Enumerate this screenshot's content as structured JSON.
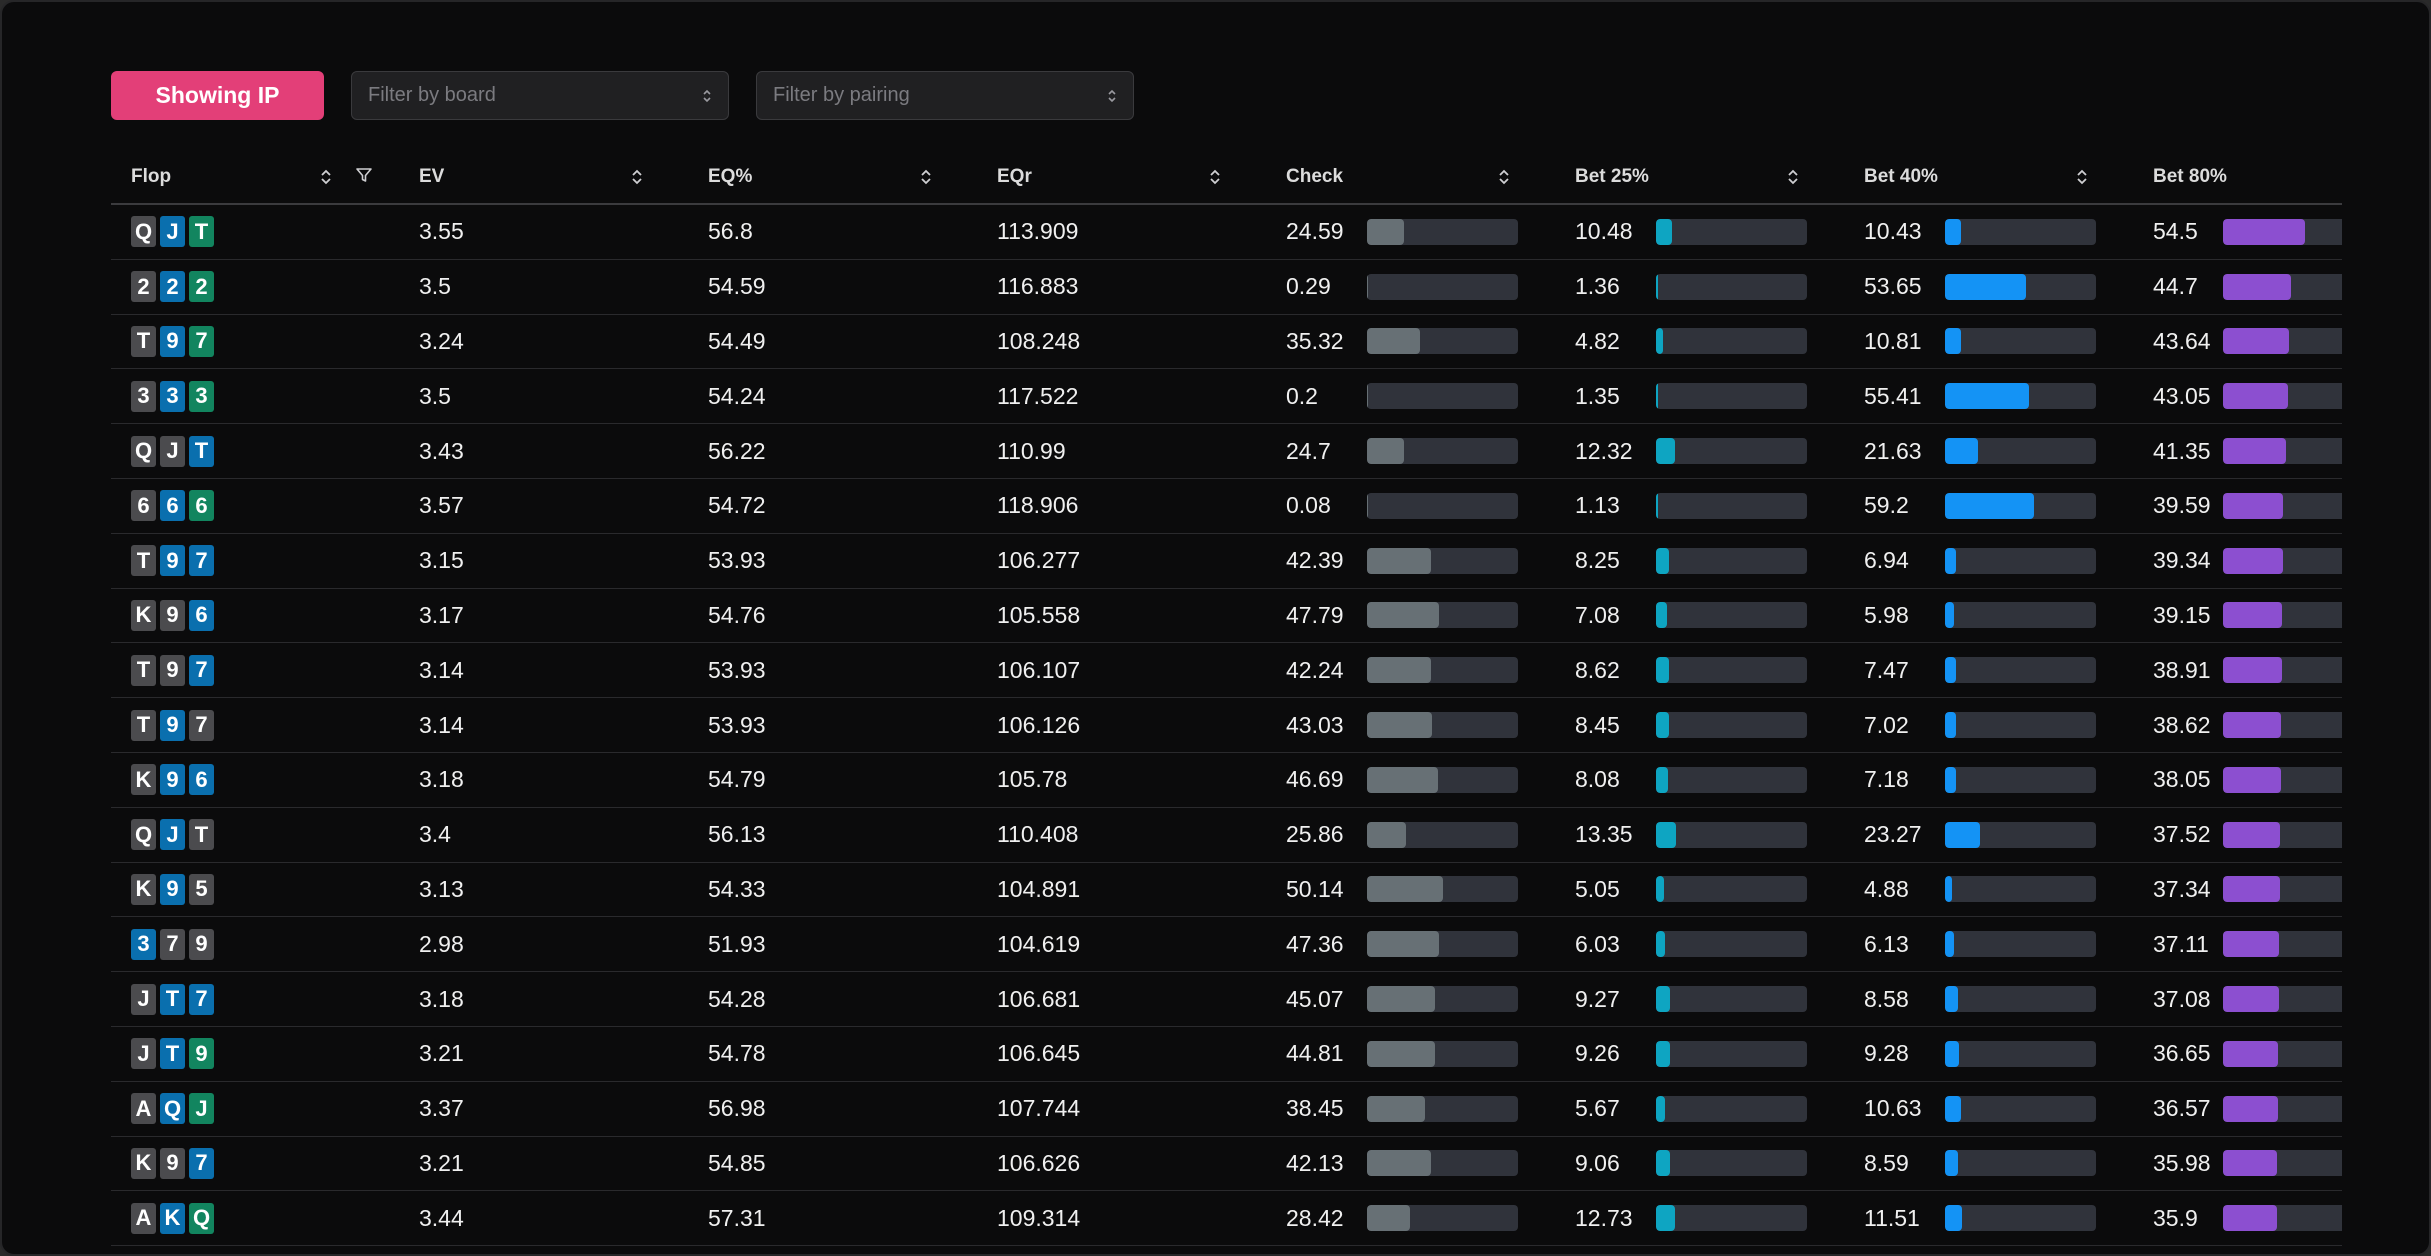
{
  "toolbar": {
    "showing_label": "Showing IP",
    "board_placeholder": "Filter by board",
    "pairing_placeholder": "Filter by pairing"
  },
  "columns": [
    "Flop",
    "EV",
    "EQ%",
    "EQr",
    "Check",
    "Bet 25%",
    "Bet 40%",
    "Bet 80%"
  ],
  "colors": {
    "accent": "#e33f78",
    "suit_gray": "#4b4b4e",
    "suit_blue": "#0a6fae",
    "suit_green": "#12855f",
    "check": "#677075",
    "bet25": "#0ea5c2",
    "bet40": "#1493f5",
    "bet80": "#8c4fd0"
  },
  "rows": [
    {
      "flop": [
        [
          "Q",
          "gray"
        ],
        [
          "J",
          "blue"
        ],
        [
          "T",
          "green"
        ]
      ],
      "ev": "3.55",
      "eq": "56.8",
      "eqr": "113.909",
      "check": "24.59",
      "b25": "10.48",
      "b40": "10.43",
      "b80": "54.5"
    },
    {
      "flop": [
        [
          "2",
          "gray"
        ],
        [
          "2",
          "blue"
        ],
        [
          "2",
          "green"
        ]
      ],
      "ev": "3.5",
      "eq": "54.59",
      "eqr": "116.883",
      "check": "0.29",
      "b25": "1.36",
      "b40": "53.65",
      "b80": "44.7"
    },
    {
      "flop": [
        [
          "T",
          "gray"
        ],
        [
          "9",
          "blue"
        ],
        [
          "7",
          "green"
        ]
      ],
      "ev": "3.24",
      "eq": "54.49",
      "eqr": "108.248",
      "check": "35.32",
      "b25": "4.82",
      "b40": "10.81",
      "b80": "43.64"
    },
    {
      "flop": [
        [
          "3",
          "gray"
        ],
        [
          "3",
          "blue"
        ],
        [
          "3",
          "green"
        ]
      ],
      "ev": "3.5",
      "eq": "54.24",
      "eqr": "117.522",
      "check": "0.2",
      "b25": "1.35",
      "b40": "55.41",
      "b80": "43.05"
    },
    {
      "flop": [
        [
          "Q",
          "gray"
        ],
        [
          "J",
          "gray"
        ],
        [
          "T",
          "blue"
        ]
      ],
      "ev": "3.43",
      "eq": "56.22",
      "eqr": "110.99",
      "check": "24.7",
      "b25": "12.32",
      "b40": "21.63",
      "b80": "41.35"
    },
    {
      "flop": [
        [
          "6",
          "gray"
        ],
        [
          "6",
          "blue"
        ],
        [
          "6",
          "green"
        ]
      ],
      "ev": "3.57",
      "eq": "54.72",
      "eqr": "118.906",
      "check": "0.08",
      "b25": "1.13",
      "b40": "59.2",
      "b80": "39.59"
    },
    {
      "flop": [
        [
          "T",
          "gray"
        ],
        [
          "9",
          "blue"
        ],
        [
          "7",
          "blue"
        ]
      ],
      "ev": "3.15",
      "eq": "53.93",
      "eqr": "106.277",
      "check": "42.39",
      "b25": "8.25",
      "b40": "6.94",
      "b80": "39.34"
    },
    {
      "flop": [
        [
          "K",
          "gray"
        ],
        [
          "9",
          "gray"
        ],
        [
          "6",
          "blue"
        ]
      ],
      "ev": "3.17",
      "eq": "54.76",
      "eqr": "105.558",
      "check": "47.79",
      "b25": "7.08",
      "b40": "5.98",
      "b80": "39.15"
    },
    {
      "flop": [
        [
          "T",
          "gray"
        ],
        [
          "9",
          "gray"
        ],
        [
          "7",
          "blue"
        ]
      ],
      "ev": "3.14",
      "eq": "53.93",
      "eqr": "106.107",
      "check": "42.24",
      "b25": "8.62",
      "b40": "7.47",
      "b80": "38.91"
    },
    {
      "flop": [
        [
          "T",
          "gray"
        ],
        [
          "9",
          "blue"
        ],
        [
          "7",
          "gray"
        ]
      ],
      "ev": "3.14",
      "eq": "53.93",
      "eqr": "106.126",
      "check": "43.03",
      "b25": "8.45",
      "b40": "7.02",
      "b80": "38.62"
    },
    {
      "flop": [
        [
          "K",
          "gray"
        ],
        [
          "9",
          "blue"
        ],
        [
          "6",
          "blue"
        ]
      ],
      "ev": "3.18",
      "eq": "54.79",
      "eqr": "105.78",
      "check": "46.69",
      "b25": "8.08",
      "b40": "7.18",
      "b80": "38.05"
    },
    {
      "flop": [
        [
          "Q",
          "gray"
        ],
        [
          "J",
          "blue"
        ],
        [
          "T",
          "gray"
        ]
      ],
      "ev": "3.4",
      "eq": "56.13",
      "eqr": "110.408",
      "check": "25.86",
      "b25": "13.35",
      "b40": "23.27",
      "b80": "37.52"
    },
    {
      "flop": [
        [
          "K",
          "gray"
        ],
        [
          "9",
          "blue"
        ],
        [
          "5",
          "gray"
        ]
      ],
      "ev": "3.13",
      "eq": "54.33",
      "eqr": "104.891",
      "check": "50.14",
      "b25": "5.05",
      "b40": "4.88",
      "b80": "37.34"
    },
    {
      "flop": [
        [
          "3",
          "blue"
        ],
        [
          "7",
          "gray"
        ],
        [
          "9",
          "gray"
        ]
      ],
      "ev": "2.98",
      "eq": "51.93",
      "eqr": "104.619",
      "check": "47.36",
      "b25": "6.03",
      "b40": "6.13",
      "b80": "37.11"
    },
    {
      "flop": [
        [
          "J",
          "gray"
        ],
        [
          "T",
          "blue"
        ],
        [
          "7",
          "blue"
        ]
      ],
      "ev": "3.18",
      "eq": "54.28",
      "eqr": "106.681",
      "check": "45.07",
      "b25": "9.27",
      "b40": "8.58",
      "b80": "37.08"
    },
    {
      "flop": [
        [
          "J",
          "gray"
        ],
        [
          "T",
          "blue"
        ],
        [
          "9",
          "green"
        ]
      ],
      "ev": "3.21",
      "eq": "54.78",
      "eqr": "106.645",
      "check": "44.81",
      "b25": "9.26",
      "b40": "9.28",
      "b80": "36.65"
    },
    {
      "flop": [
        [
          "A",
          "gray"
        ],
        [
          "Q",
          "blue"
        ],
        [
          "J",
          "green"
        ]
      ],
      "ev": "3.37",
      "eq": "56.98",
      "eqr": "107.744",
      "check": "38.45",
      "b25": "5.67",
      "b40": "10.63",
      "b80": "36.57"
    },
    {
      "flop": [
        [
          "K",
          "gray"
        ],
        [
          "9",
          "gray"
        ],
        [
          "7",
          "blue"
        ]
      ],
      "ev": "3.21",
      "eq": "54.85",
      "eqr": "106.626",
      "check": "42.13",
      "b25": "9.06",
      "b40": "8.59",
      "b80": "35.98"
    },
    {
      "flop": [
        [
          "A",
          "gray"
        ],
        [
          "K",
          "blue"
        ],
        [
          "Q",
          "green"
        ]
      ],
      "ev": "3.44",
      "eq": "57.31",
      "eqr": "109.314",
      "check": "28.42",
      "b25": "12.73",
      "b40": "11.51",
      "b80": "35.9"
    }
  ]
}
